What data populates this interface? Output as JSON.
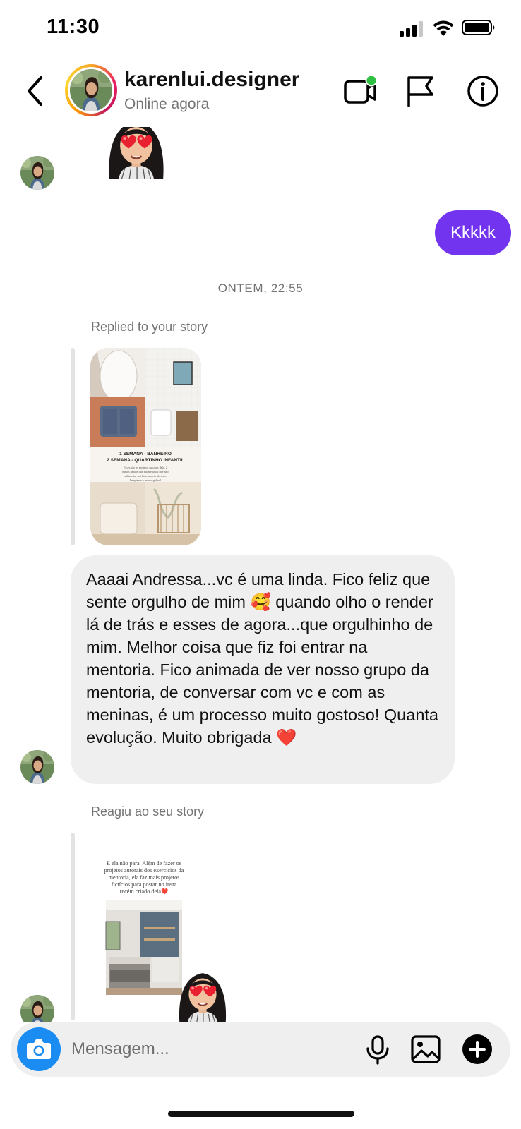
{
  "status_bar": {
    "time": "11:30"
  },
  "header": {
    "username": "karenlui.designer",
    "status": "Online agora",
    "icons": [
      "back-chevron-icon",
      "video-call-icon",
      "flag-icon",
      "info-icon"
    ],
    "online_dot_color": "#2ec043"
  },
  "messages": {
    "sent_text": "Kkkkk",
    "timestamp": "ONTEM, 22:55",
    "reply1_label": "Replied to your story",
    "story1": {
      "line1": "1 SEMANA - BANHEIRO",
      "line2": "2 SEMANA - QUARTINHO INFANTIL",
      "caption": [
        "Esses são os projetos autorais dela, 2",
        "meses depois que ela me falou que não",
        "sabia criar um bom projeto do zero.",
        "Imaginem o meu orgulho?"
      ]
    },
    "received_text": "Aaaai Andressa...vc é uma linda. Fico feliz que sente orgulho de mim 🥰 quando olho o render lá de trás e esses de agora...que orgulhinho de mim. Melhor coisa que fiz foi entrar na mentoria. Fico animada de ver nosso grupo da mentoria, de conversar com vc e com as meninas, é um processo muito gostoso! Quanta evolução. Muito obrigada ❤️",
    "reply2_label": "Reagiu ao seu story",
    "story2": {
      "caption": [
        "E ela não para. Além de fazer os",
        "projetos autorais dos exercícios da",
        "mentoria, ela faz mais projetos",
        "fictícios para postar no insta",
        "recém criado dela❤️"
      ]
    }
  },
  "composer": {
    "placeholder": "Mensagem...",
    "icons": [
      "camera-icon",
      "microphone-icon",
      "gallery-icon",
      "add-icon"
    ]
  },
  "colors": {
    "sent_bubble": "#7334ef",
    "received_bubble": "#efefef",
    "camera_button": "#1a8cf2"
  }
}
